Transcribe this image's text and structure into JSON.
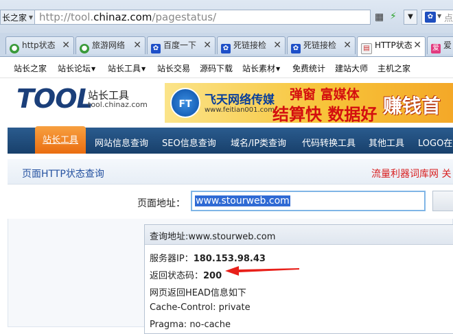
{
  "browser": {
    "site_tag": "长之家",
    "url_prefix": "http://tool.",
    "url_domain": "chinaz.com",
    "url_path": "/pagestatus/",
    "search_placeholder": "点"
  },
  "tabs": [
    {
      "label": "http状态",
      "icon": "globe-green-icon"
    },
    {
      "label": "旅游网络",
      "icon": "globe-green-icon"
    },
    {
      "label": "百度一下",
      "icon": "paw-icon"
    },
    {
      "label": "死链接检",
      "icon": "paw-icon"
    },
    {
      "label": "死链接检",
      "icon": "paw-icon"
    },
    {
      "label": "HTTP状态",
      "icon": "doc-icon",
      "active": true
    },
    {
      "label": "爱",
      "icon": "love-icon"
    }
  ],
  "site_nav": [
    {
      "label": "站长之家",
      "dropdown": false
    },
    {
      "label": "站长论坛",
      "dropdown": true
    },
    {
      "label": "站长工具",
      "dropdown": true
    },
    {
      "label": "站长交易",
      "dropdown": false
    },
    {
      "label": "源码下载",
      "dropdown": false
    },
    {
      "label": "站长素材",
      "dropdown": true
    },
    {
      "label": "免费统计",
      "dropdown": false
    },
    {
      "label": "建站大师",
      "dropdown": false
    },
    {
      "label": "主机之家",
      "dropdown": false
    }
  ],
  "logo": {
    "main": "TOOL",
    "cn": "站长工具",
    "domain": "tool.chinaz.com"
  },
  "banner": {
    "ft": "FT",
    "name": "飞天网络传媒",
    "site": "www.feitian001.com",
    "slogan1": "弹窗 富媒体",
    "slogan2": "结算快 数据好",
    "slogan3": "赚钱首"
  },
  "main_nav": {
    "active": "站长工具",
    "items": [
      "网站信息查询",
      "SEO信息查询",
      "域名/IP类查询",
      "代码转换工具",
      "其他工具",
      "LOGO在线"
    ]
  },
  "page": {
    "title": "页面HTTP状态查询",
    "ad": "流量利器词库网  关",
    "url_label": "页面地址：",
    "url_value": "www.stourweb.com"
  },
  "result": {
    "query_line": "查询地址:www.stourweb.com",
    "ip_label": "服务器IP：",
    "ip_value": "180.153.98.43",
    "status_label": "返回状态码：",
    "status_value": "200",
    "head_intro": "网页返回HEAD信息如下",
    "cache_control": "Cache-Control: private",
    "pragma": "Pragma: no-cache"
  },
  "colors": {
    "nav_bg": "#1f4b7c",
    "nav_active": "#f08a24",
    "link_blue": "#2451a0",
    "ad_red": "#d81e1e",
    "arrow_red": "#e8201a"
  }
}
